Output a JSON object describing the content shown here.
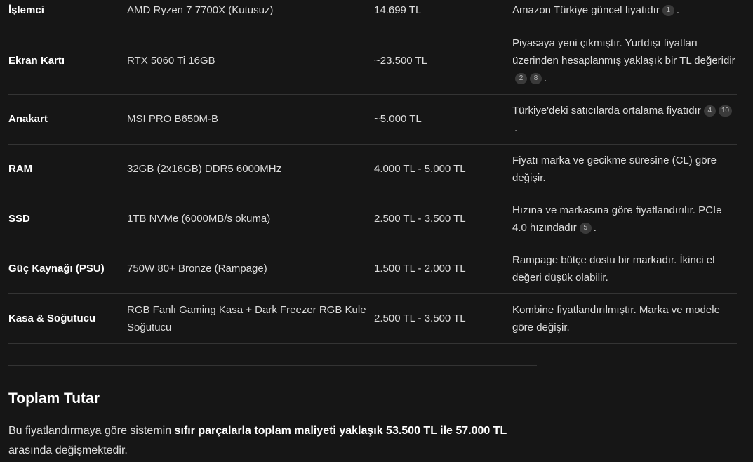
{
  "table": {
    "rows": [
      {
        "component": "İşlemci",
        "model": "AMD Ryzen 7 7700X (Kutusuz)",
        "price": "14.699 TL",
        "note": "Amazon Türkiye güncel fiyatıdır",
        "cites": [
          "1"
        ]
      },
      {
        "component": "Ekran Kartı",
        "model": "RTX 5060 Ti 16GB",
        "price": "~23.500 TL",
        "note": "Piyasaya yeni çıkmıştır. Yurtdışı fiyatları üzerinden hesaplanmış yaklaşık bir TL değeridir",
        "cites": [
          "2",
          "8"
        ]
      },
      {
        "component": "Anakart",
        "model": "MSI PRO B650M-B",
        "price": "~5.000 TL",
        "note": "Türkiye'deki satıcılarda ortalama fiyatıdır",
        "cites": [
          "4",
          "10"
        ]
      },
      {
        "component": "RAM",
        "model": "32GB (2x16GB) DDR5 6000MHz",
        "price": "4.000 TL - 5.000 TL",
        "note": "Fiyatı marka ve gecikme süresine (CL) göre değişir.",
        "cites": []
      },
      {
        "component": "SSD",
        "model": "1TB NVMe (6000MB/s okuma)",
        "price": "2.500 TL - 3.500 TL",
        "note": "Hızına ve markasına göre fiyatlandırılır. PCIe 4.0 hızındadır",
        "cites": [
          "5"
        ]
      },
      {
        "component": "Güç Kaynağı (PSU)",
        "model": "750W 80+ Bronze (Rampage)",
        "price": "1.500 TL - 2.000 TL",
        "note": "Rampage bütçe dostu bir markadır. İkinci el değeri düşük olabilir.",
        "cites": []
      },
      {
        "component": "Kasa & Soğutucu",
        "model": "RGB Fanlı Gaming Kasa + Dark Freezer RGB Kule Soğutucu",
        "price": "2.500 TL - 3.500 TL",
        "note": "Kombine fiyatlandırılmıştır. Marka ve modele göre değişir.",
        "cites": []
      }
    ]
  },
  "total": {
    "title": "Toplam Tutar",
    "text_before": "Bu fiyatlandırmaya göre sistemin ",
    "text_bold": "sıfır parçalarla toplam maliyeti yaklaşık 53.500 TL ile 57.000 TL",
    "text_after": " arasında değişmektedir."
  }
}
